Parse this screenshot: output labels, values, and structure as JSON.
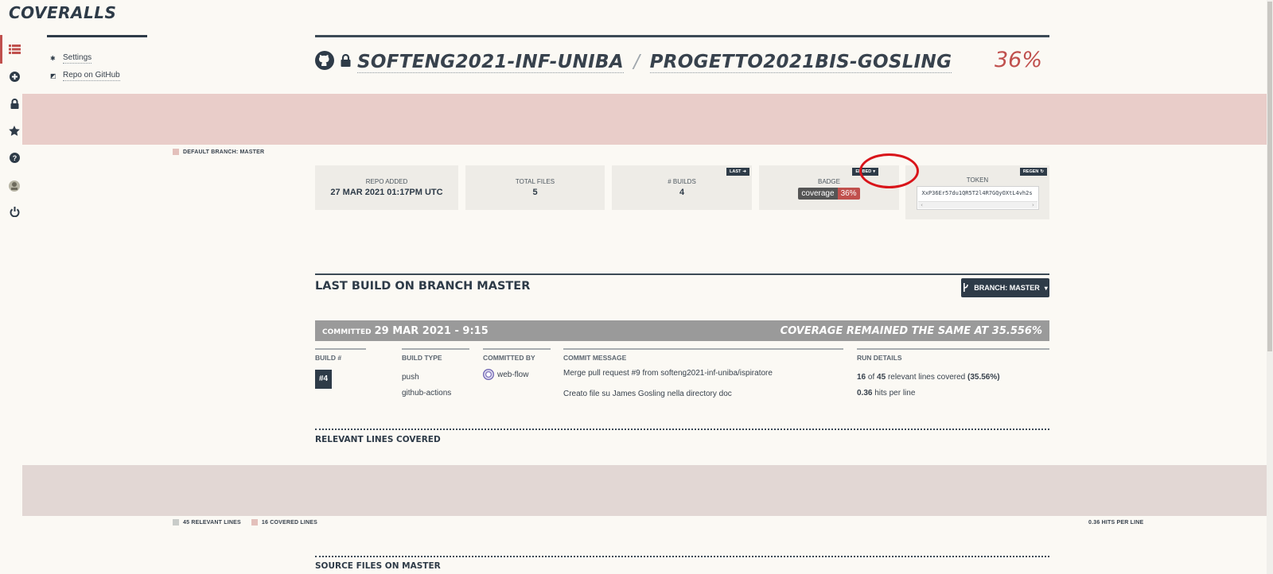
{
  "app": {
    "logo": "COVERALLS"
  },
  "rail": {
    "icons": [
      {
        "name": "repos-list-icon",
        "glyph": "☰"
      },
      {
        "name": "add-repo-icon",
        "glyph": "⊕"
      },
      {
        "name": "lock-icon",
        "glyph": "🔒"
      },
      {
        "name": "star-icon",
        "glyph": "★"
      },
      {
        "name": "help-icon",
        "glyph": "?"
      },
      {
        "name": "user-avatar-icon",
        "glyph": "☻"
      },
      {
        "name": "power-icon",
        "glyph": "⏻"
      }
    ]
  },
  "subnav": {
    "settings": "Settings",
    "repo_on_github": "Repo on GitHub"
  },
  "repo": {
    "org": "SOFTENG2021-INF-UNIBA",
    "separator": "/",
    "name": "PROGETTO2021BIS-GOSLING",
    "coverage_pct": "36%"
  },
  "legend_top": {
    "default_branch": "DEFAULT BRANCH: MASTER"
  },
  "stats": {
    "repo_added_label": "REPO ADDED",
    "repo_added_value": "27 MAR 2021 01:17PM UTC",
    "total_files_label": "TOTAL FILES",
    "total_files_value": "5",
    "builds_label": "# BUILDS",
    "builds_value": "4",
    "last_btn": "LAST",
    "badge_label": "BADGE",
    "badge_left": "coverage",
    "badge_right": "36%",
    "embed_btn": "EMBED",
    "token_label": "TOKEN",
    "token_value": "XxP36Er57du1QR5T2l4R7GQyOXtL4vh2s",
    "regen_btn": "REGEN"
  },
  "last_build": {
    "title": "LAST BUILD ON BRANCH MASTER",
    "branch_button": "BRANCH: MASTER",
    "committed_prefix": "COMMITTED",
    "committed_date": "29 MAR 2021 - 9:15",
    "coverage_status": "COVERAGE REMAINED THE SAME AT 35.556%",
    "columns": {
      "build_num_head": "BUILD #",
      "build_num": "#4",
      "build_type_head": "BUILD TYPE",
      "build_type_1": "push",
      "build_type_2": "github-actions",
      "committed_by_head": "COMMITTED BY",
      "committed_by": "web-flow",
      "commit_msg_head": "COMMIT MESSAGE",
      "commit_msg_1": "Merge pull request #9 from softeng2021-inf-uniba/ispiratore",
      "commit_msg_2": "Creato file su James Gosling nella directory doc",
      "run_details_head": "RUN DETAILS",
      "covered_n": "16",
      "covered_of": "of",
      "relevant_n": "45",
      "covered_text": "relevant lines covered",
      "covered_pct": "(35.56%)",
      "hits": "0.36",
      "hits_text": "hits per line"
    }
  },
  "relevant_lines": {
    "title": "RELEVANT LINES COVERED",
    "legend_relevant": "45 RELEVANT LINES",
    "legend_covered": "16 COVERED LINES",
    "hits_per_line": "0.36 HITS PER LINE"
  },
  "source_files": {
    "title": "SOURCE FILES ON MASTER"
  },
  "colors": {
    "accent_red": "#c0504d",
    "navy": "#2e3b48",
    "band_top": "#e9cdc9",
    "band_bottom": "#e2d7d4",
    "swatch_relevant": "#c9ccc9",
    "swatch_covered": "#e3c0bb"
  }
}
